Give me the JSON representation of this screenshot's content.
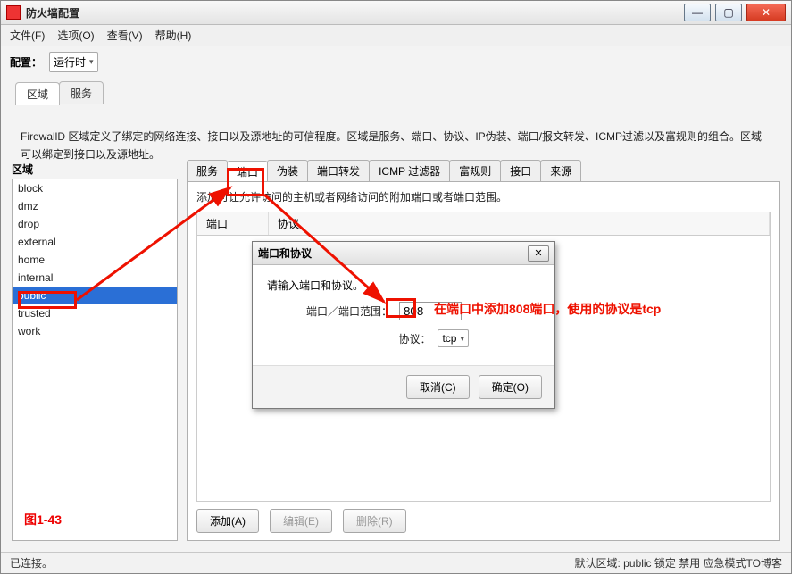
{
  "window": {
    "title": "防火墙配置"
  },
  "menu": {
    "file": "文件(F)",
    "options": "选项(O)",
    "view": "查看(V)",
    "help": "帮助(H)"
  },
  "config": {
    "label": "配置：",
    "mode": "运行时"
  },
  "outer_tabs": {
    "zone": "区域",
    "services": "服务"
  },
  "description": "FirewallD 区域定义了绑定的网络连接、接口以及源地址的可信程度。区域是服务、端口、协议、IP伪装、端口/报文转发、ICMP过滤以及富规则的组合。区域可以绑定到接口以及源地址。",
  "zone": {
    "heading": "区域",
    "items": [
      "block",
      "dmz",
      "drop",
      "external",
      "home",
      "internal",
      "public",
      "trusted",
      "work"
    ],
    "selected": "public"
  },
  "inner_tabs": [
    "服务",
    "端口",
    "伪装",
    "端口转发",
    "ICMP 过滤器",
    "富规则",
    "接口",
    "来源"
  ],
  "inner_active": "端口",
  "inner_hint": "添加可让允许访问的主机或者网络访问的附加端口或者端口范围。",
  "table_cols": {
    "port": "端口",
    "proto": "协议"
  },
  "buttons": {
    "add": "添加(A)",
    "edit": "编辑(E)",
    "delete": "删除(R)"
  },
  "dialog": {
    "title": "端口和协议",
    "prompt": "请输入端口和协议。",
    "port_label": "端口／端口范围：",
    "port_value": "808",
    "proto_label": "协议：",
    "proto_value": "tcp",
    "cancel": "取消(C)",
    "ok": "确定(O)"
  },
  "annotation": {
    "text": "在端口中添加808端口，使用的协议是tcp"
  },
  "figure": "图1-43",
  "status": {
    "left": "已连接。",
    "right": "默认区域: public 锁定 禁用 应急模式TO博客"
  }
}
